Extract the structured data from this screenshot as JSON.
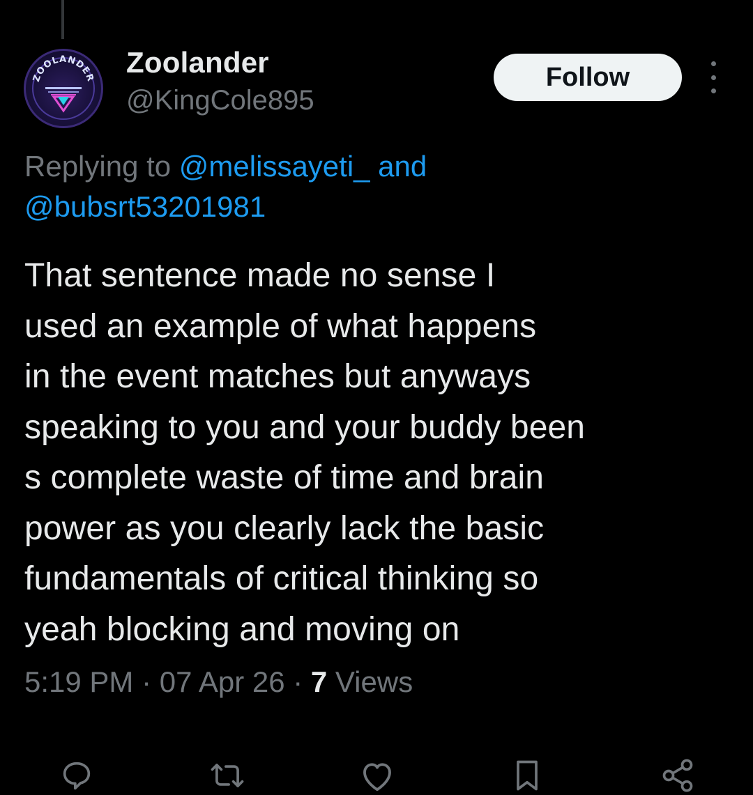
{
  "author": {
    "display_name": "Zoolander",
    "handle": "@KingCole895",
    "avatar_text": "ZOOLANDER"
  },
  "header": {
    "follow_label": "Follow",
    "more_icon": "more-vertical-icon"
  },
  "reply_context": {
    "prefix": "Replying to ",
    "mention_1": "@melissayeti_",
    "conjunction": " and",
    "mention_2": "@bubsrt53201981"
  },
  "tweet": {
    "lines": [
      "That sentence made no sense I",
      "used an example of what happens",
      "in the event matches but anyways",
      "speaking to you and your buddy been",
      "s complete waste of time and brain",
      "power as you clearly lack the basic",
      "fundamentals of critical thinking so",
      "yeah blocking and moving on"
    ]
  },
  "meta": {
    "time": "5:19 PM",
    "separator": " · ",
    "date": "07 Apr 26",
    "views_count": "7",
    "views_label": " Views"
  },
  "actions": [
    {
      "icon": "reply-icon"
    },
    {
      "icon": "retweet-icon"
    },
    {
      "icon": "like-icon"
    },
    {
      "icon": "bookmark-icon"
    },
    {
      "icon": "share-icon"
    }
  ],
  "colors": {
    "background": "#000000",
    "primary_text": "#e7e9ea",
    "secondary_text": "#71767b",
    "link": "#1d9bf0",
    "follow_bg": "#eff3f4"
  }
}
